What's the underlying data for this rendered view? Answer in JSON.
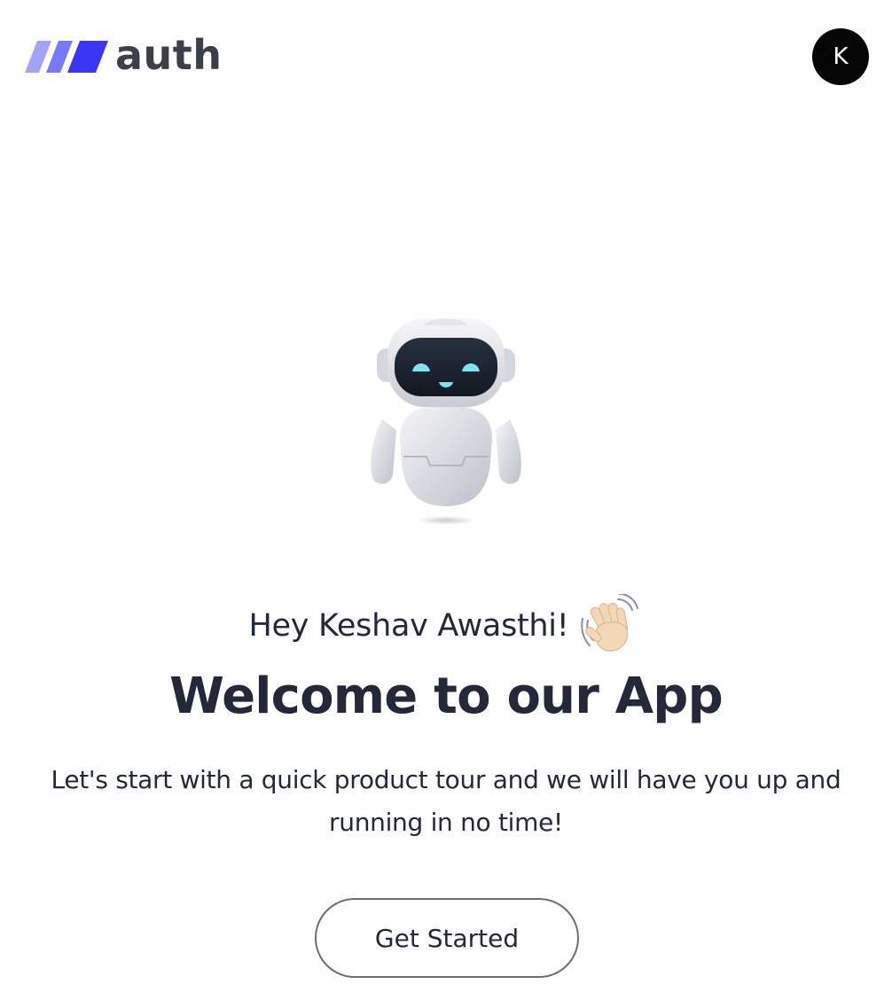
{
  "header": {
    "logo_text": "auth",
    "avatar_initial": "K"
  },
  "welcome": {
    "greeting": "Hey Keshav Awasthi!",
    "title": "Welcome to our App",
    "subtitle": "Let's start with a quick product tour and we will have you up and running in no time!",
    "cta_label": "Get Started"
  },
  "icons": {
    "logo": "three-slanted-bars-logo-icon",
    "robot": "robot-mascot-illustration",
    "wave": "waving-hand-icon"
  },
  "colors": {
    "brand_light": "#a4a3fb",
    "brand_mid": "#7a78fa",
    "brand_dark": "#3a36f5",
    "text": "#232938",
    "avatar_bg": "#050505",
    "button_border": "#6b6e78"
  }
}
